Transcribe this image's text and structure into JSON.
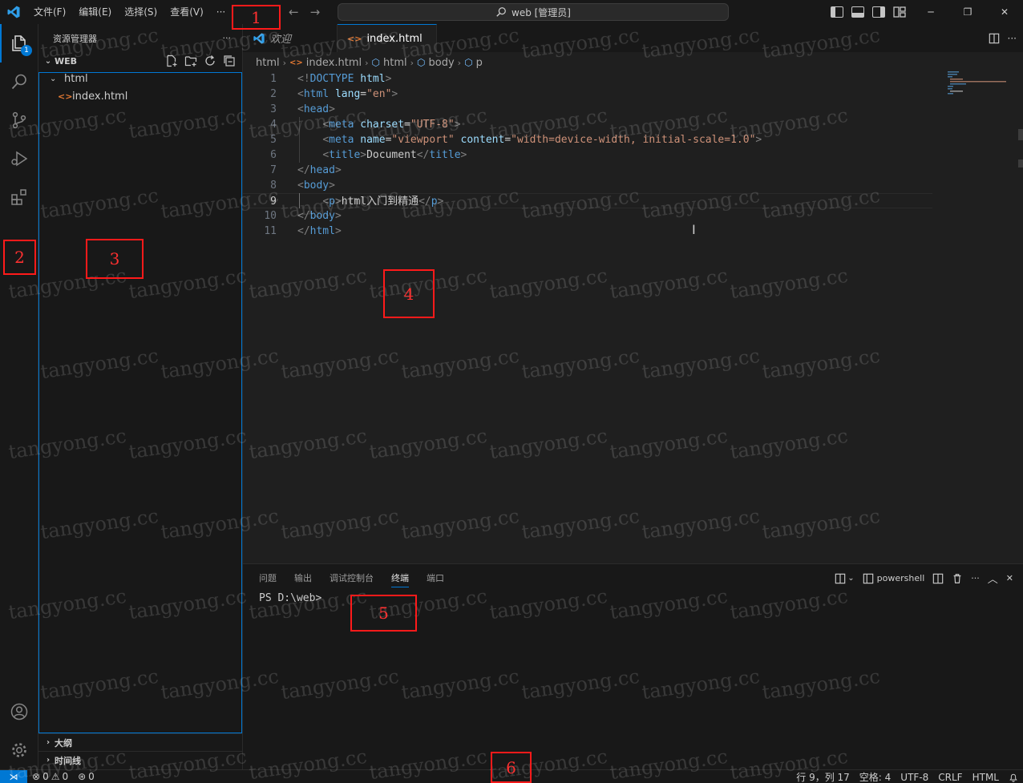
{
  "titlebar": {
    "menus": [
      "文件(F)",
      "编辑(E)",
      "选择(S)",
      "查看(V)",
      "···"
    ],
    "command_center": "web [管理员]",
    "back": "←",
    "forward": "→",
    "minimize": "─",
    "restore": "❐",
    "close": "✕"
  },
  "activity": {
    "explorer_badge": "1"
  },
  "sidebar": {
    "title": "资源管理器",
    "more": "···",
    "section": "WEB",
    "tree": [
      {
        "label": "html",
        "type": "folder"
      },
      {
        "label": "index.html",
        "type": "file"
      }
    ],
    "outline": "大纲",
    "timeline": "时间线"
  },
  "tabs": [
    {
      "label": "欢迎",
      "active": false
    },
    {
      "label": "index.html",
      "active": true
    }
  ],
  "breadcrumb": [
    "html",
    "index.html",
    "html",
    "body",
    "p"
  ],
  "code": {
    "line_numbers": [
      "1",
      "2",
      "3",
      "4",
      "5",
      "6",
      "7",
      "8",
      "9",
      "10",
      "11"
    ],
    "current_line": 9
  },
  "panel": {
    "tabs": [
      "问题",
      "输出",
      "调试控制台",
      "终端",
      "端口"
    ],
    "active_tab": "终端",
    "shell": "powershell",
    "prompt": "PS D:\\web>"
  },
  "status": {
    "errors": "0",
    "warnings": "0",
    "ports": "0",
    "position": "行 9，列 17",
    "spaces": "空格: 4",
    "encoding": "UTF-8",
    "eol": "CRLF",
    "language": "HTML"
  },
  "annotations": [
    "1",
    "2",
    "3",
    "4",
    "5",
    "6"
  ],
  "watermark": "tangyong.cc",
  "colors": {
    "accent": "#0078d4",
    "annotation": "#ff1a1a",
    "background": "#1f1f1f",
    "chrome": "#181818"
  }
}
